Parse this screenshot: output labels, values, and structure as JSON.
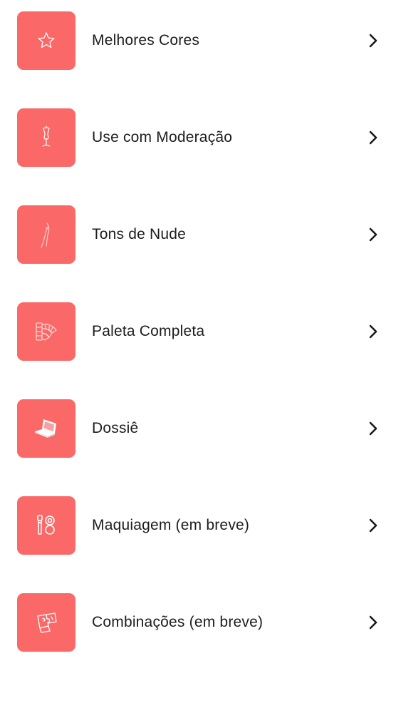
{
  "accent_color": "#fa6867",
  "menu": {
    "items": [
      {
        "label": "Melhores Cores",
        "icon": "star-icon"
      },
      {
        "label": "Use com Moderação",
        "icon": "mannequin-icon"
      },
      {
        "label": "Tons de Nude",
        "icon": "dress-icon"
      },
      {
        "label": "Paleta Completa",
        "icon": "color-swatch-fan-icon"
      },
      {
        "label": "Dossiê",
        "icon": "laptop-icon"
      },
      {
        "label": "Maquiagem (em breve)",
        "icon": "makeup-icon"
      },
      {
        "label": "Combinações (em breve)",
        "icon": "puzzle-icon"
      }
    ]
  }
}
